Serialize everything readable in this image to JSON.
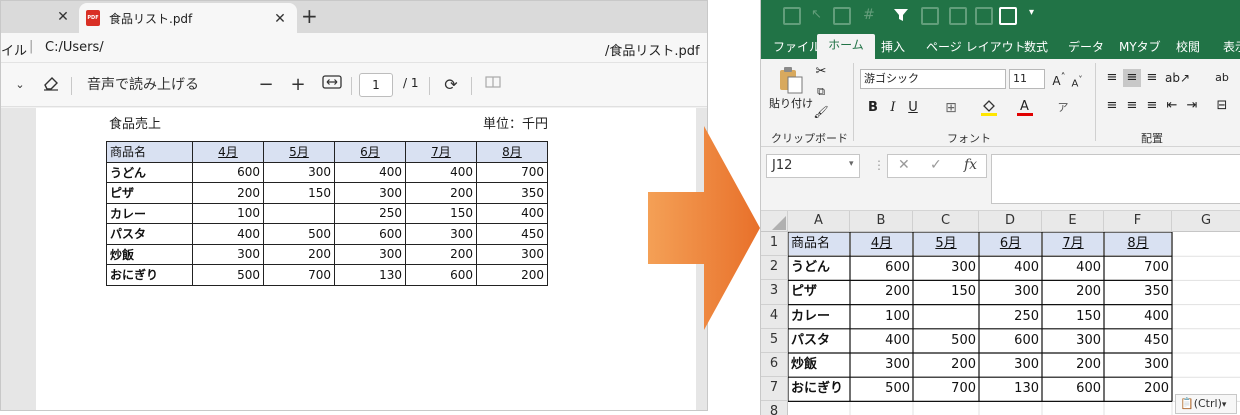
{
  "pdf_viewer": {
    "tab_title": "食品リスト.pdf",
    "address_left": "イル",
    "address_path": "C:/Users/",
    "address_right": "/食品リスト.pdf",
    "read_aloud_label": "音声で読み上げる",
    "page_current": "1",
    "page_total": "/ 1",
    "doc_title": "食品売上",
    "unit_label": "単位：千円"
  },
  "table": {
    "header": [
      "商品名",
      "4月",
      "5月",
      "6月",
      "7月",
      "8月"
    ],
    "rows": [
      [
        "うどん",
        "600",
        "300",
        "400",
        "400",
        "700"
      ],
      [
        "ピザ",
        "200",
        "150",
        "300",
        "200",
        "350"
      ],
      [
        "カレー",
        "100",
        "",
        "250",
        "150",
        "400"
      ],
      [
        "パスタ",
        "400",
        "500",
        "600",
        "300",
        "450"
      ],
      [
        "炒飯",
        "300",
        "200",
        "300",
        "200",
        "300"
      ],
      [
        "おにぎり",
        "500",
        "700",
        "130",
        "600",
        "200"
      ]
    ]
  },
  "excel": {
    "ribbon_tabs": [
      "ファイル",
      "ホーム",
      "挿入",
      "ページ レイアウト",
      "数式",
      "データ",
      "MYタブ",
      "校閲",
      "表示"
    ],
    "active_tab": "ホーム",
    "clipboard_group": "クリップボード",
    "font_group": "フォント",
    "align_group": "配置",
    "paste_label": "貼り付け",
    "font_name": "游ゴシック",
    "font_size": "11",
    "name_box": "J12",
    "fx_label": "fx",
    "column_headers": [
      "A",
      "B",
      "C",
      "D",
      "E",
      "F",
      "G"
    ],
    "row_headers": [
      "1",
      "2",
      "3",
      "4",
      "5",
      "6",
      "7",
      "8"
    ],
    "paste_options": "(Ctrl)"
  },
  "colors": {
    "excel_green": "#217346",
    "header_fill": "#d9e1f2",
    "arrow_orange": "#f07f30"
  }
}
